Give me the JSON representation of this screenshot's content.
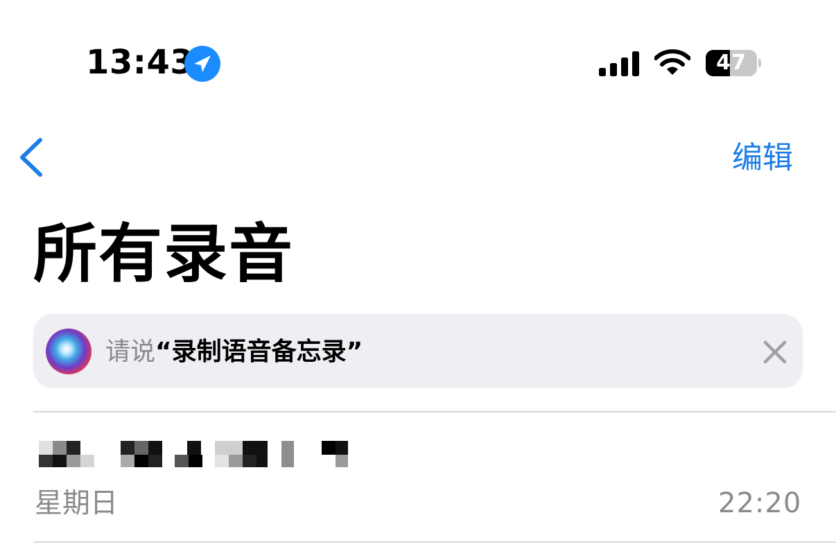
{
  "status_bar": {
    "time": "13:43",
    "battery_level": "47",
    "battery_fraction": 0.47,
    "location_icon": "location-arrow-icon",
    "signal_icon": "cellular-signal-icon",
    "wifi_icon": "wifi-icon",
    "accent": "#1a8cff"
  },
  "nav": {
    "back_icon": "chevron-left-icon",
    "edit_label": "编辑",
    "accent": "#1c7ee6"
  },
  "page": {
    "title": "所有录音"
  },
  "siri_tip": {
    "prefix": "请说",
    "phrase": "“录制语音备忘录”",
    "icon": "siri-icon",
    "close_icon": "close-icon"
  },
  "recordings": [
    {
      "title_redacted": true,
      "date": "星期日",
      "time": "22:20"
    }
  ]
}
